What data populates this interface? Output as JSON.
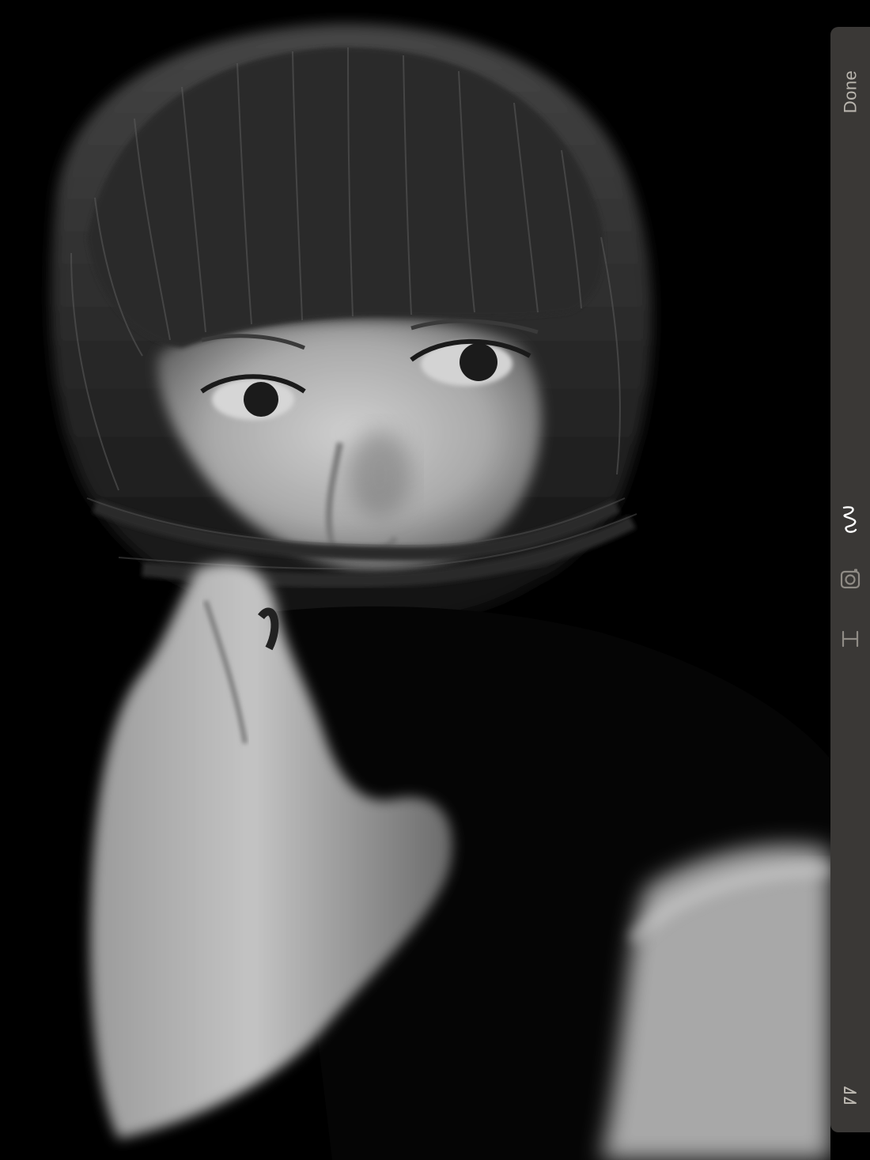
{
  "toolbar": {
    "done_label": "Done",
    "tools": [
      {
        "icon": "squiggle-draw-icon",
        "active": true
      },
      {
        "icon": "camera-icon",
        "active": false
      },
      {
        "icon": "text-cursor-icon",
        "active": false
      }
    ],
    "collapse_icon": "double-chevron-icon"
  },
  "colors": {
    "toolbar_bg": "#3a3836",
    "toolbar_text": "#b9b5ae",
    "active_icon": "#ffffff",
    "inactive_icon": "#8f8b85",
    "canvas_bg": "#000000"
  }
}
